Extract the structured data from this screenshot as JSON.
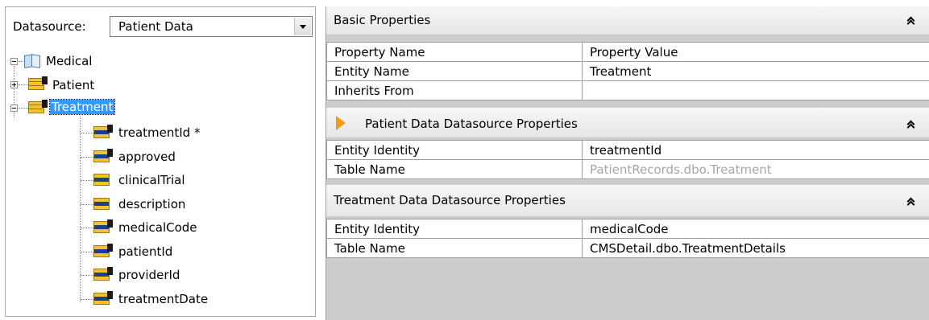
{
  "datasource": {
    "label": "Datasource:",
    "selected": "Patient Data"
  },
  "tree": {
    "root": "Medical",
    "tables": [
      {
        "label": "Patient",
        "expanded": false
      },
      {
        "label": "Treatment",
        "expanded": true,
        "selected": true
      }
    ],
    "fields": [
      "treatmentId *",
      "approved",
      "clinicalTrial",
      "description",
      "medicalCode",
      "patientId",
      "providerId",
      "treatmentDate"
    ]
  },
  "sections": {
    "basic": {
      "title": "Basic Properties",
      "headers": [
        "Property Name",
        "Property Value"
      ],
      "rows": [
        [
          "Entity Name",
          "Treatment"
        ],
        [
          "Inherits From",
          ""
        ]
      ]
    },
    "patient_ds": {
      "title": "Patient Data Datasource Properties",
      "rows": [
        [
          "Entity Identity",
          "treatmentId"
        ],
        [
          "Table Name",
          "PatientRecords.dbo.Treatment"
        ]
      ]
    },
    "treatment_ds": {
      "title": "Treatment Data Datasource Properties",
      "rows": [
        [
          "Entity Identity",
          "medicalCode"
        ],
        [
          "Table Name",
          "CMSDetail.dbo.TreatmentDetails"
        ]
      ]
    }
  },
  "colors": {
    "selection": "#3399ff",
    "accent_arrow": "#f39c12",
    "muted_text": "#a6a6a6",
    "empty_area": "#cccccc"
  }
}
